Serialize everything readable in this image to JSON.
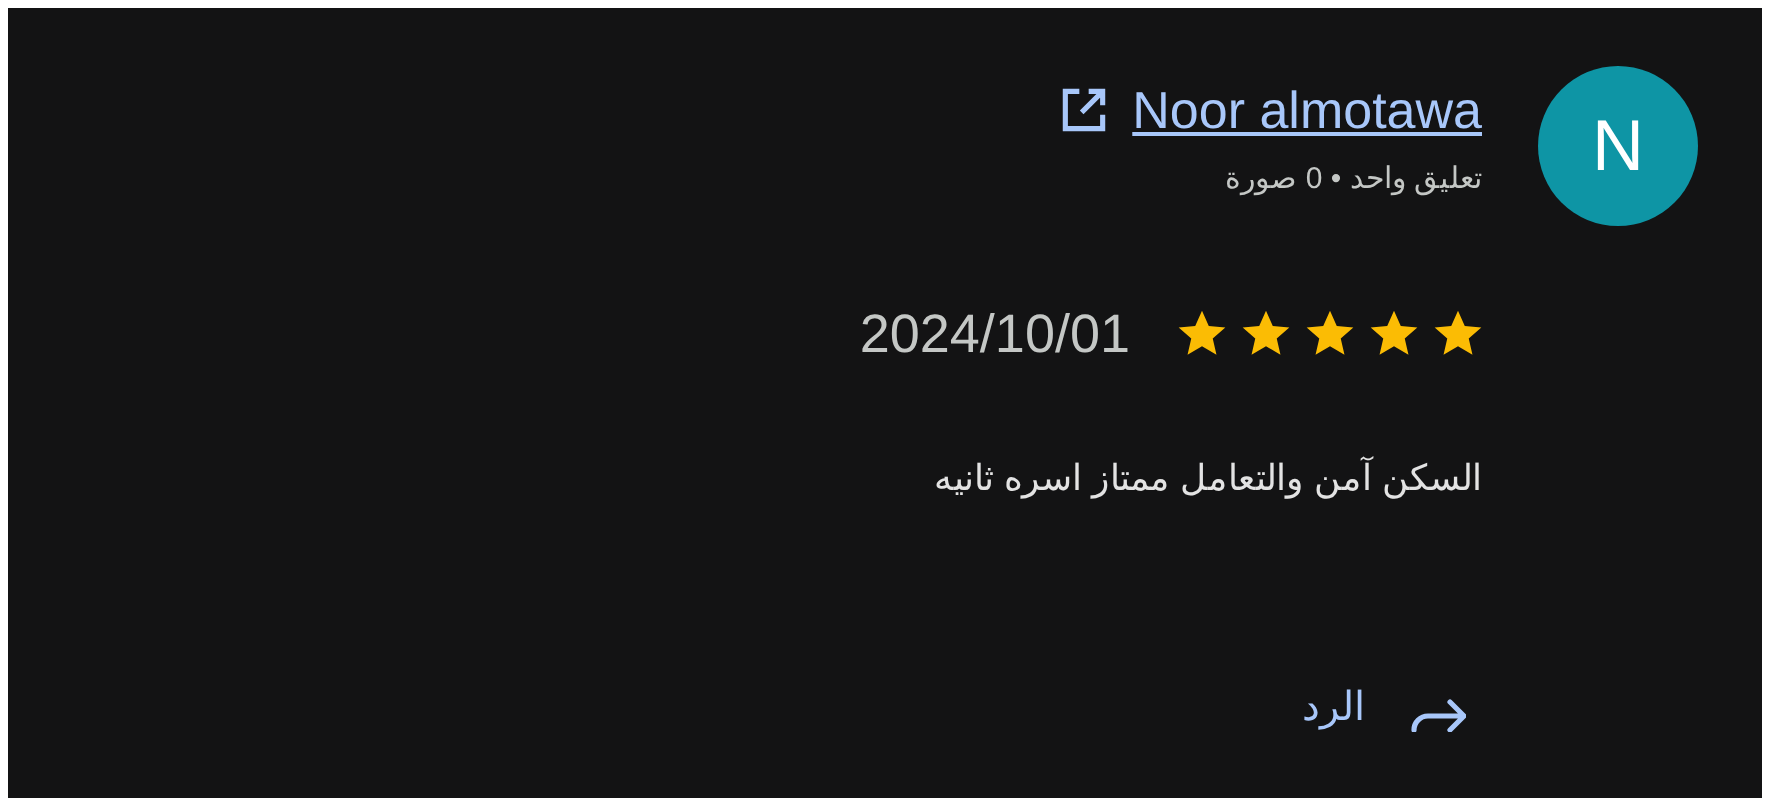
{
  "review": {
    "avatar_letter": "N",
    "author": "Noor almotawa",
    "author_meta": "تعليق واحد • 0 صورة",
    "stars": 5,
    "date": "2024/10/01",
    "text": "السكن آمن والتعامل ممتاز اسره ثانيه",
    "reply_label": "الرد"
  }
}
